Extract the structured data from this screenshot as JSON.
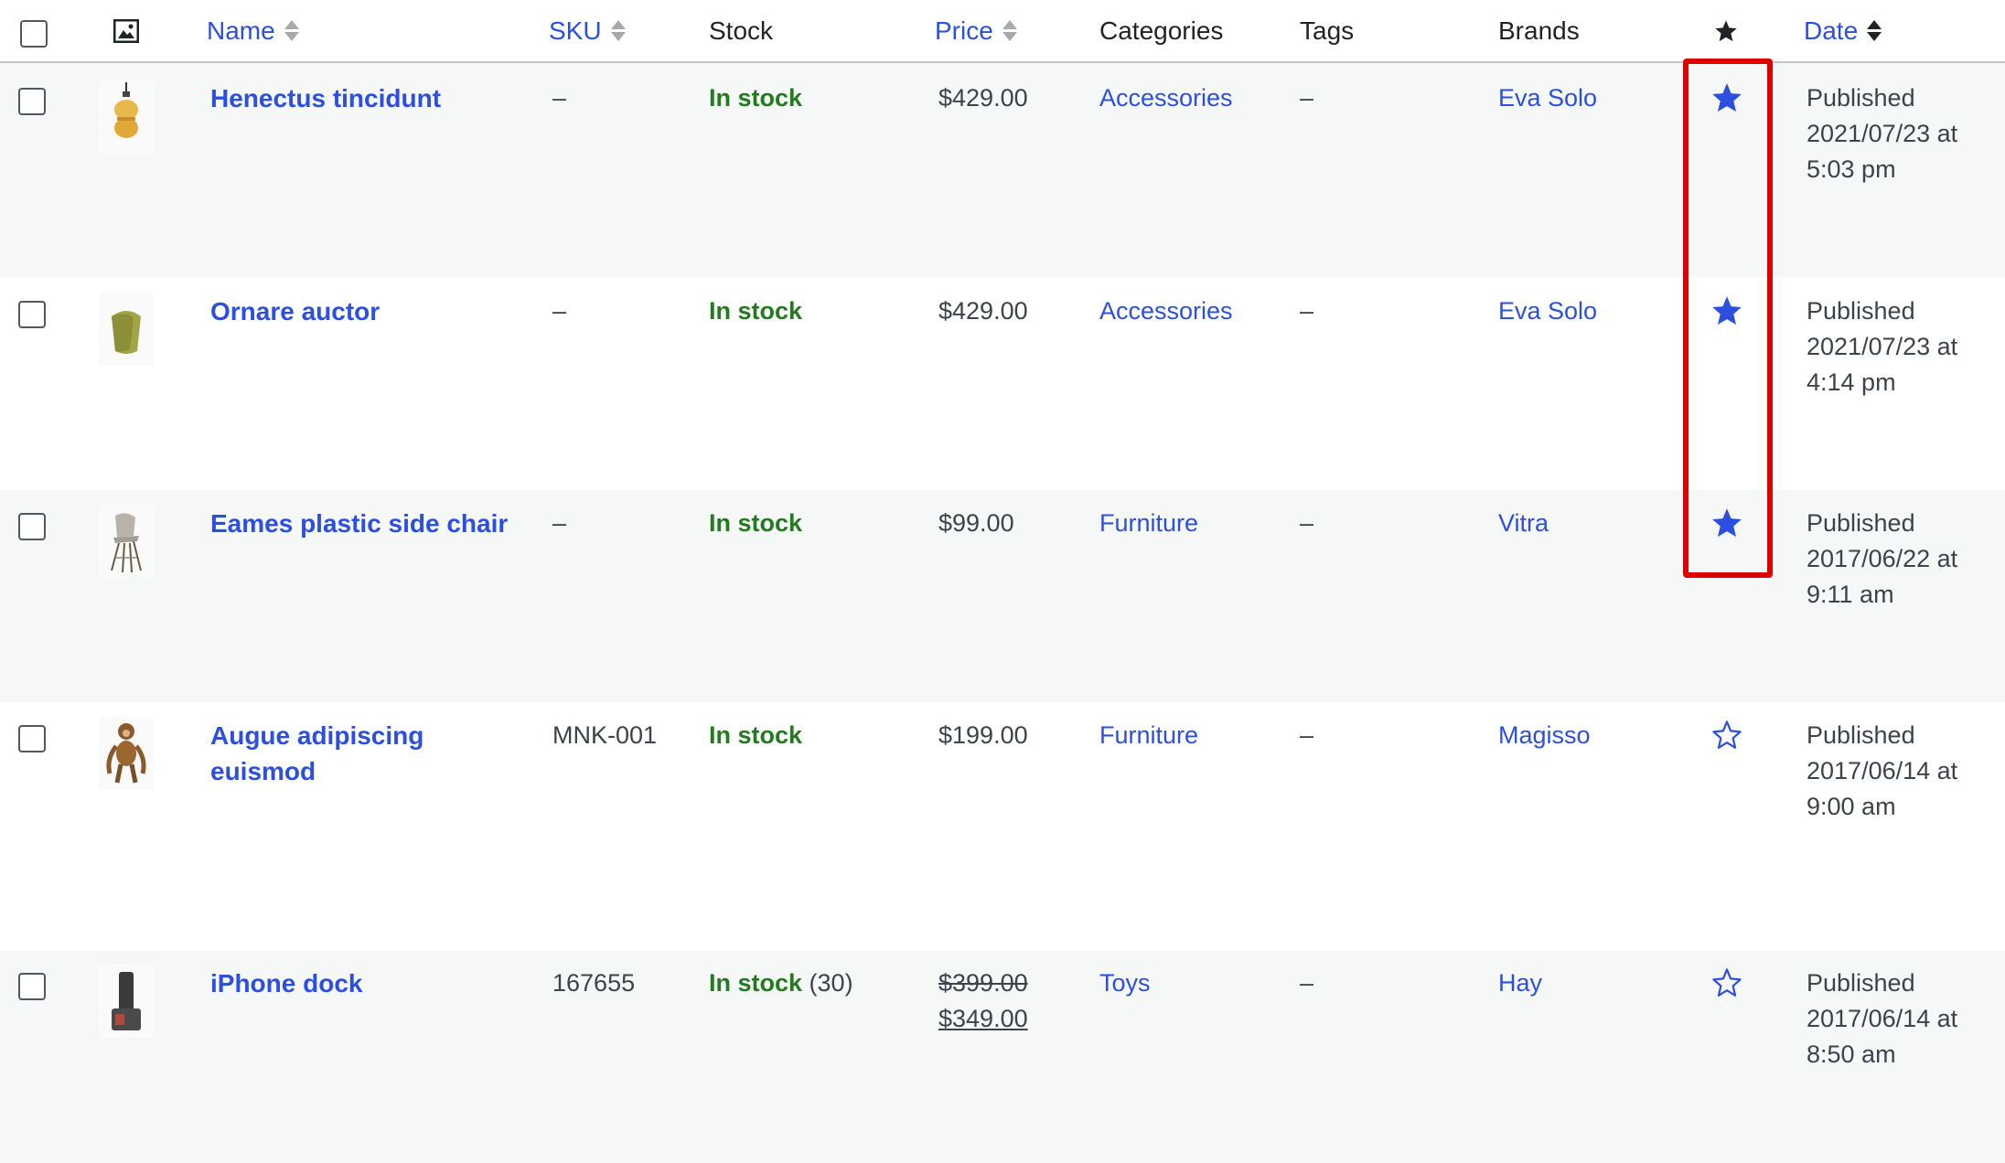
{
  "columns": {
    "name": "Name",
    "sku": "SKU",
    "stock": "Stock",
    "price": "Price",
    "categories": "Categories",
    "tags": "Tags",
    "brands": "Brands",
    "featured_icon": "star-filled-icon",
    "date": "Date"
  },
  "products": [
    {
      "name": "Henectus tincidunt",
      "sku": "–",
      "stock": "In stock",
      "price": "$429.00",
      "category": "Accessories",
      "tags": "–",
      "brand": "Eva Solo",
      "featured": true,
      "date_status": "Published",
      "date_line": "2021/07/23 at",
      "date_time": "5:03 pm"
    },
    {
      "name": "Ornare auctor",
      "sku": "–",
      "stock": "In stock",
      "price": "$429.00",
      "category": "Accessories",
      "tags": "–",
      "brand": "Eva Solo",
      "featured": true,
      "date_status": "Published",
      "date_line": "2021/07/23 at",
      "date_time": "4:14 pm"
    },
    {
      "name": "Eames plastic side chair",
      "sku": "–",
      "stock": "In stock",
      "price": "$99.00",
      "category": "Furniture",
      "tags": "–",
      "brand": "Vitra",
      "featured": true,
      "date_status": "Published",
      "date_line": "2017/06/22 at",
      "date_time": "9:11 am"
    },
    {
      "name": "Augue adipiscing euismod",
      "sku": "MNK-001",
      "stock": "In stock",
      "price": "$199.00",
      "category": "Furniture",
      "tags": "–",
      "brand": "Magisso",
      "featured": false,
      "date_status": "Published",
      "date_line": "2017/06/14 at",
      "date_time": "9:00 am"
    },
    {
      "name": "iPhone dock",
      "sku": "167655",
      "stock": "In stock",
      "stock_count": "(30)",
      "price_regular": "$399.00",
      "price_sale": "$349.00",
      "category": "Toys",
      "tags": "–",
      "brand": "Hay",
      "featured": false,
      "date_status": "Published",
      "date_line": "2017/06/14 at",
      "date_time": "8:50 am"
    }
  ],
  "colors": {
    "link": "#2c4fe0",
    "in_stock": "#237a1f",
    "highlight": "#dd0000",
    "alt_row": "#f6f7f7"
  }
}
